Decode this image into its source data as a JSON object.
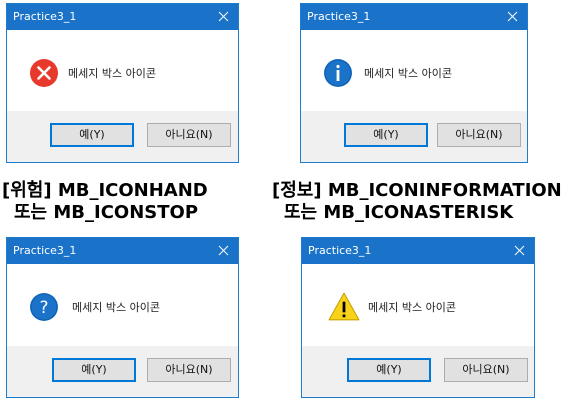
{
  "dialogs": [
    {
      "title": "Practice3_1",
      "icon": "error-icon",
      "message": "메세지 박스 아이콘",
      "buttons": {
        "yes": "예(Y)",
        "no": "아니요(N)"
      },
      "icon_color": "#e8392d"
    },
    {
      "title": "Practice3_1",
      "icon": "information-icon",
      "message": "메세지 박스 아이콘",
      "buttons": {
        "yes": "예(Y)",
        "no": "아니요(N)"
      },
      "icon_color": "#1a73c9"
    },
    {
      "title": "Practice3_1",
      "icon": "question-icon",
      "message": "메세지 박스 아이콘",
      "buttons": {
        "yes": "예(Y)",
        "no": "아니요(N)"
      },
      "icon_color": "#1a73c9"
    },
    {
      "title": "Practice3_1",
      "icon": "warning-icon",
      "message": "메세지 박스 아이콘",
      "buttons": {
        "yes": "예(Y)",
        "no": "아니요(N)"
      },
      "icon_color": "#f9d21a"
    }
  ],
  "captions": {
    "left": {
      "line1": "[위험] MB_ICONHAND",
      "line2": "또는 MB_ICONSTOP"
    },
    "right": {
      "line1": "[정보] MB_ICONINFORMATION",
      "line2": "또는 MB_ICONASTERISK"
    }
  },
  "colors": {
    "titlebar": "#1a73c9",
    "footer": "#f0f0f0",
    "default_button_border": "#0078d7"
  }
}
